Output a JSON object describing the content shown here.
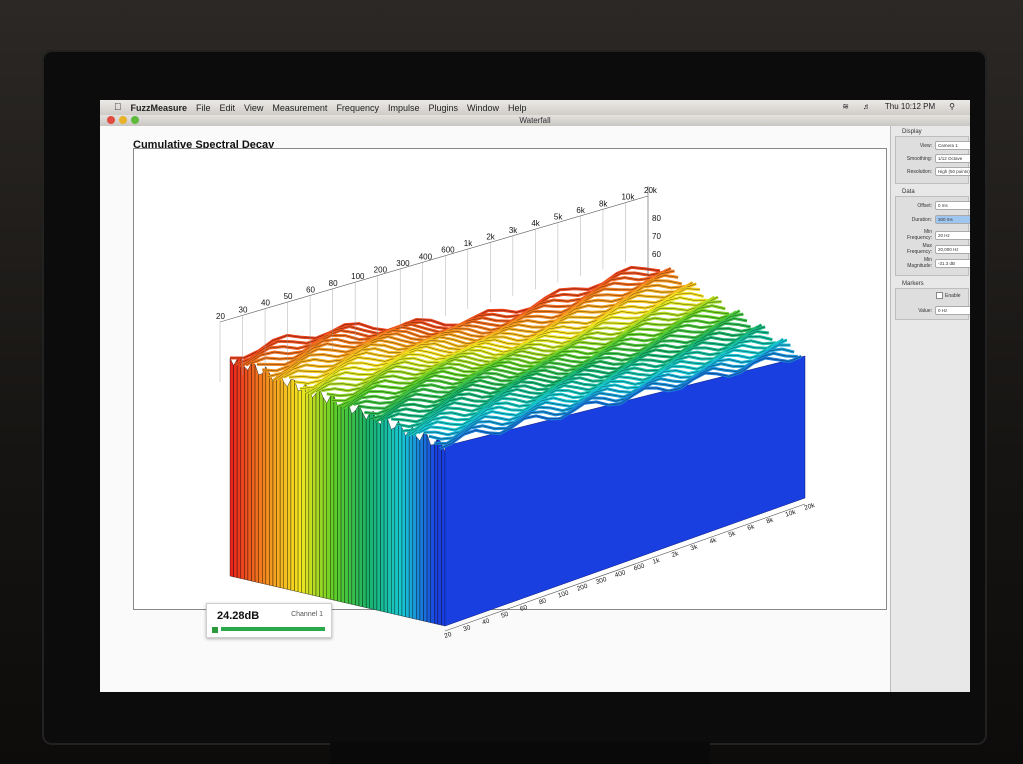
{
  "menubar": {
    "app": "FuzzMeasure",
    "items": [
      "File",
      "Edit",
      "View",
      "Measurement",
      "Frequency",
      "Impulse",
      "Plugins",
      "Window",
      "Help"
    ],
    "clock": "Thu 10:12 PM"
  },
  "window": {
    "title": "Waterfall"
  },
  "chart": {
    "title": "Cumulative Spectral Decay"
  },
  "chart_data": {
    "type": "waterfall-3d",
    "title": "Cumulative Spectral Decay",
    "frequency_ticks_back": [
      "20",
      "30",
      "40",
      "50",
      "60",
      "80",
      "100",
      "200",
      "300",
      "400",
      "600",
      "1k",
      "2k",
      "3k",
      "4k",
      "5k",
      "6k",
      "8k",
      "10k",
      "20k"
    ],
    "frequency_ticks_front": [
      "20",
      "30",
      "40",
      "50",
      "60",
      "80",
      "100",
      "200",
      "300",
      "400",
      "600",
      "1k",
      "2k",
      "3k",
      "4k",
      "5k",
      "6k",
      "8k",
      "10k",
      "20k"
    ],
    "magnitude_ticks": [
      "80",
      "70",
      "60"
    ],
    "color_scale": [
      "#e8251c",
      "#f58b1e",
      "#f5e620",
      "#5fcf27",
      "#18b36a",
      "#18c9d6",
      "#1a3fe0"
    ]
  },
  "level_meter": {
    "value": "24.28dB",
    "channel": "Channel 1",
    "fill": 1.0
  },
  "sidepanel": {
    "display": {
      "title": "Display",
      "view_label": "View:",
      "view_value": "Camera 1",
      "smoothing_label": "Smoothing:",
      "smoothing_value": "1/12 Octave",
      "resolution_label": "Resolution:",
      "resolution_value": "High (50 points)"
    },
    "data": {
      "title": "Data",
      "offset_label": "Offset:",
      "offset_value": "0 ms",
      "duration_label": "Duration:",
      "duration_value": "300 ms",
      "minfreq_label": "Min Frequency:",
      "minfreq_value": "20 Hz",
      "maxfreq_label": "Max Frequency:",
      "maxfreq_value": "20,000 Hz",
      "minmag_label": "Min Magnitude:",
      "minmag_value": "-31.3 dB"
    },
    "markers": {
      "title": "Markers",
      "enable_label": "Enable",
      "value_label": "Value:",
      "value_value": "0 Hz"
    }
  },
  "colors": {
    "accent": "#1a3fe0",
    "meter": "#2aa94a"
  }
}
